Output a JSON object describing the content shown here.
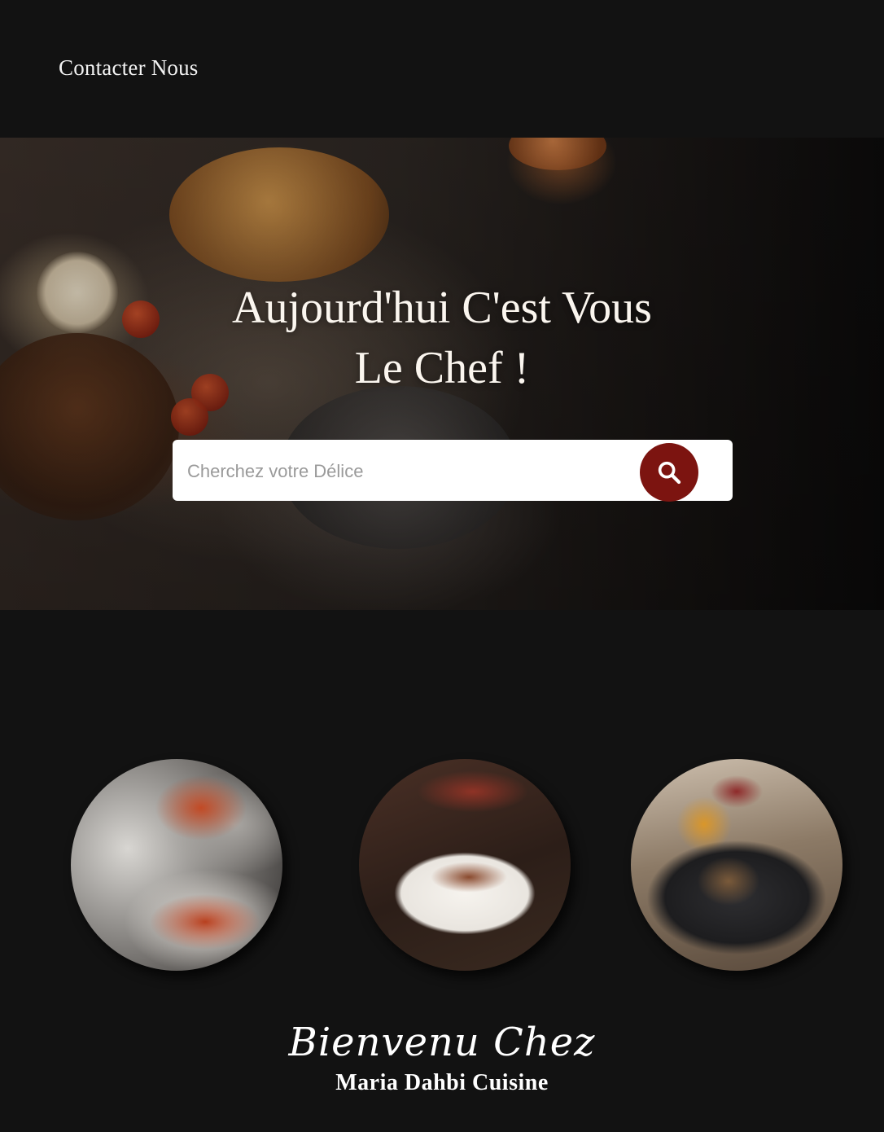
{
  "nav": {
    "contact_label": "Contacter Nous"
  },
  "hero": {
    "title_line1": "Aujourd'hui C'est Vous",
    "title_line2": "Le Chef !",
    "search": {
      "placeholder": "Cherchez votre Délice",
      "value": ""
    },
    "search_button_icon": "search-icon"
  },
  "dishes": [
    {
      "name": "pizza-plate"
    },
    {
      "name": "duck-plate"
    },
    {
      "name": "stone-grill-plate"
    }
  ],
  "welcome": {
    "script_text": "Bienvenu Chez",
    "subtitle": "Maria Dahbi Cuisine"
  },
  "colors": {
    "background": "#121212",
    "accent": "#7c1410",
    "text": "#ffffff"
  }
}
